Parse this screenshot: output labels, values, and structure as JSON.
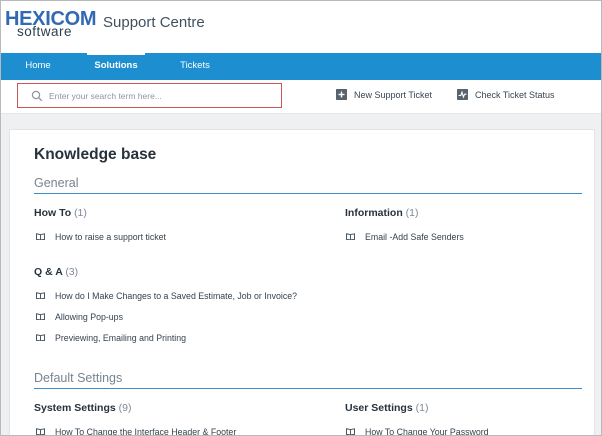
{
  "header": {
    "logo_top": "HEXICOM",
    "logo_bottom": "software",
    "site_title": "Support Centre"
  },
  "nav": {
    "items": [
      {
        "label": "Home",
        "active": false
      },
      {
        "label": "Solutions",
        "active": true
      },
      {
        "label": "Tickets",
        "active": false
      }
    ]
  },
  "toolbar": {
    "search_placeholder": "Enter your search term here...",
    "new_ticket_label": "New Support Ticket",
    "check_status_label": "Check Ticket Status"
  },
  "knowledge_base": {
    "title": "Knowledge base",
    "sections": [
      {
        "title": "General",
        "categories": [
          {
            "name": "How To",
            "count": "(1)",
            "articles": [
              "How to raise a support ticket"
            ]
          },
          {
            "name": "Information",
            "count": "(1)",
            "articles": [
              "Email -Add Safe Senders"
            ]
          },
          {
            "name": "Q & A",
            "count": "(3)",
            "articles": [
              "How do I Make Changes to a Saved Estimate, Job or Invoice?",
              "Allowing Pop-ups",
              "Previewing, Emailing and Printing"
            ]
          }
        ]
      },
      {
        "title": "Default Settings",
        "categories": [
          {
            "name": "System Settings",
            "count": "(9)",
            "articles": [
              "How To Change the Interface Header & Footer"
            ]
          },
          {
            "name": "User Settings",
            "count": "(1)",
            "articles": [
              "How To Change Your Password"
            ]
          }
        ]
      }
    ]
  },
  "colors": {
    "nav_bg": "#1d8fd1",
    "brand_blue": "#3269b3",
    "section_rule": "#3c8fcf",
    "search_border": "#c95555"
  },
  "icons": {
    "search": "search-icon",
    "new_ticket": "plus-square-icon",
    "check_status": "activity-icon",
    "article": "book-icon"
  }
}
